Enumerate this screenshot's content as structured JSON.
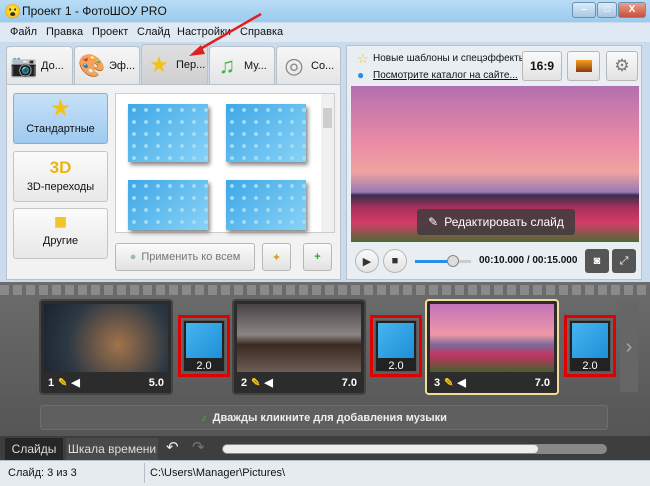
{
  "window": {
    "title": "Проект 1 - ФотоШОУ PRO",
    "min": "–",
    "max": "□",
    "close": "X"
  },
  "menu": [
    "Файл",
    "Правка",
    "Проект",
    "Слайд",
    "Настройки",
    "Справка"
  ],
  "tabs": [
    "До...",
    "Эф...",
    "Пер...",
    "Му...",
    "Со..."
  ],
  "categories": [
    "Стандартные",
    "3D-переходы",
    "Другие"
  ],
  "cat3d": "3D",
  "apply_all": "Применить ко всем",
  "info": {
    "line1": "Новые шаблоны и спецэффекты",
    "line2": "Посмотрите каталог на сайте...",
    "ratio": "16:9"
  },
  "edit_slide": "Редактировать слайд",
  "player": {
    "time": "00:10.000 / 00:15.000",
    "progress": 0.67
  },
  "slides": [
    {
      "n": "1",
      "d": "5.0"
    },
    {
      "n": "2",
      "d": "7.0"
    },
    {
      "n": "3",
      "d": "7.0"
    }
  ],
  "transitions": [
    "2.0",
    "2.0",
    "2.0"
  ],
  "music_hint": "Дважды кликните для добавления музыки",
  "bottom_tabs": [
    "Слайды",
    "Шкала времени"
  ],
  "status": {
    "slide": "Слайд: 3 из 3",
    "path": "C:\\Users\\Manager\\Pictures\\"
  }
}
